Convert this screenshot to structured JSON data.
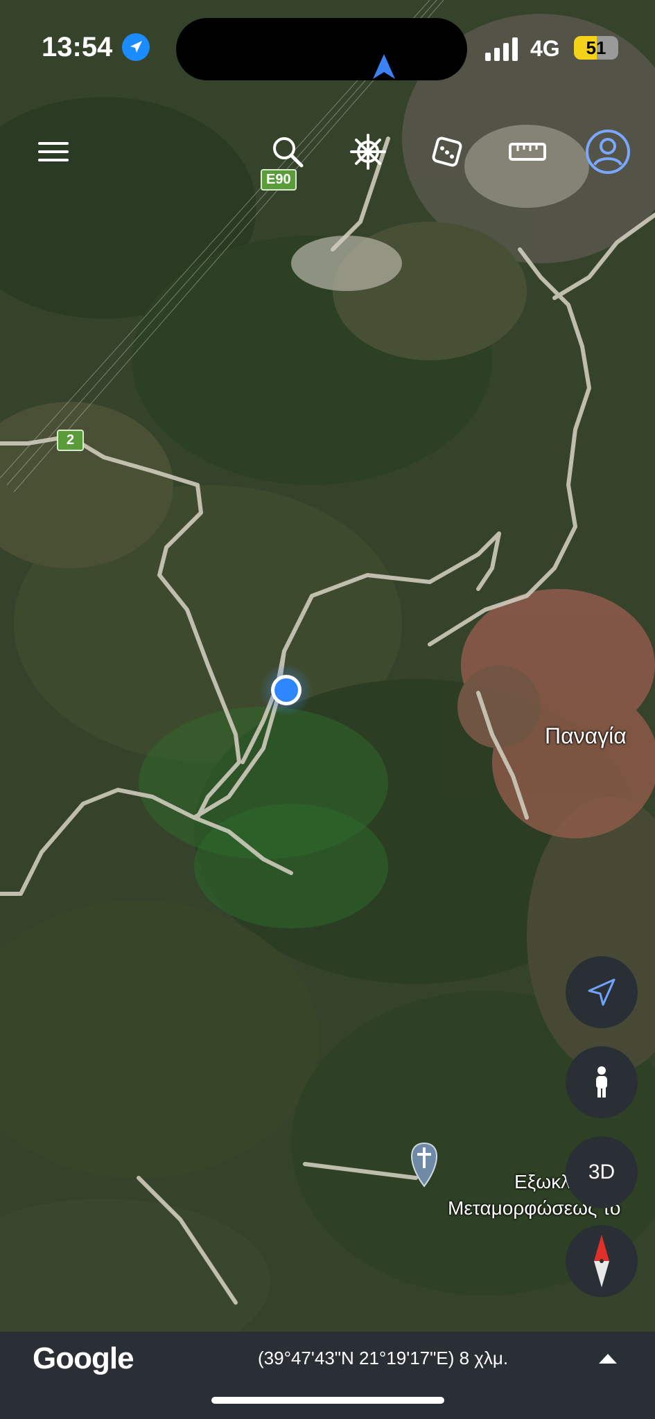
{
  "status_bar": {
    "time": "13:54",
    "network": "4G",
    "battery_level": "51",
    "battery_fraction": 0.51
  },
  "toolbar": {
    "menu_icon": "hamburger-menu-icon",
    "search_icon": "search-icon",
    "voyager_icon": "ship-wheel-icon",
    "random_icon": "dice-icon",
    "measure_icon": "ruler-icon",
    "profile_icon": "account-icon"
  },
  "map": {
    "road_shields": [
      "E90",
      "2"
    ],
    "place_label": "Παναγία",
    "church_label_line1": "Εξωκλ...",
    "church_label_line2": "Μεταμορφώσεως το",
    "church_label_line1_text": "Εξωκλ",
    "church_label_line2_text": "Μεταμορφώσεως το"
  },
  "controls": {
    "three_d_label": "3D"
  },
  "bottom_bar": {
    "logo": "Google",
    "coordinates": "(39°47'43\"N 21°19'17\"E) 8 χλμ."
  },
  "colors": {
    "accent_blue": "#1a8cff",
    "battery_yellow": "#f5d21a",
    "shield_green": "#5a9b3a",
    "compass_red": "#e0302a"
  }
}
